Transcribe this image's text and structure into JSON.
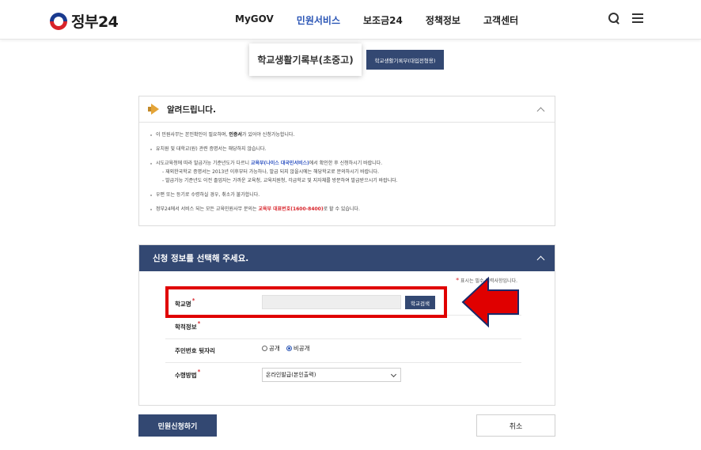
{
  "header": {
    "logo_text": "정부24",
    "nav": [
      "MyGOV",
      "민원서비스",
      "보조금24",
      "정책정보",
      "고객센터"
    ],
    "active_nav": "민원서비스"
  },
  "tabs": {
    "main": "학교생활기록부(초중고)",
    "sub": "학교생활기록부(대입전형용)"
  },
  "notice": {
    "title": "알려드립니다.",
    "line1_pre": "이 민원사무는 본인확인이 필요하며, ",
    "line1_bold": "인증서",
    "line1_post": "가 있어야 신청가능합니다.",
    "line2": "유치원 및 대학교(원) 관련 증명서는 해당하지 않습니다.",
    "line3_pre": "시도교육청에 따라 발급가능 기준년도가 다르니 ",
    "line3_link": "교육부(나이스 대국민서비스)",
    "line3_post": "에서 확인한 후 신청하시기 바랍니다.",
    "line4": "- 재외한국학교 증명서는 2013년 이후부터 가능하나, 발급 되지 않을시에는 해당학교로 문의하시기 바랍니다.",
    "line5": "- 발급가능 기준년도 이전 졸업자는 가까운 교육청, 교육지원청, 각급학교 및 지자체를 방문하여 발급받으시기 바랍니다.",
    "line6": "우편 또는 등기로 수령하실 경우, 취소가 불가합니다.",
    "line7_pre": "정부24에서 서비스 되는 모든 교육민원사무 문의는 ",
    "line7_red": "교육부 대표번호(1600-8400)",
    "line7_post": "로 할 수 있습니다."
  },
  "form": {
    "title": "신청 정보를 선택해 주세요.",
    "required_note": "표시는 필수 입력사항입니다.",
    "school_label": "학교명",
    "school_value": "",
    "school_search_button": "학교검색",
    "record_label": "학적정보",
    "ssn_label": "주민번호 뒷자리",
    "ssn_options": [
      "공개",
      "비공개"
    ],
    "ssn_selected": "비공개",
    "receive_label": "수령방법",
    "receive_value": "온라인발급(본인출력)"
  },
  "buttons": {
    "apply": "민원신청하기",
    "cancel": "취소"
  },
  "colors": {
    "navy": "#334872",
    "accent_blue": "#2a55b5",
    "highlight_red": "#e00000"
  }
}
